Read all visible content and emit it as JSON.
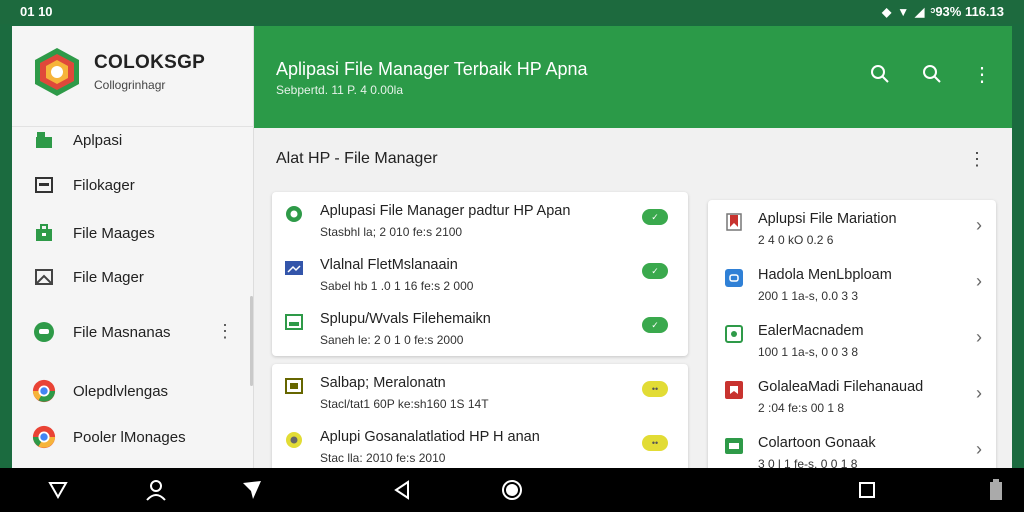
{
  "status_bar": {
    "time": "01 10",
    "battery_text": "ᵓ93% 116.13"
  },
  "drawer": {
    "brand_name": "COLOKSGP",
    "brand_sub": "Collogrinhagr",
    "items": [
      {
        "label": "Aplpasi",
        "icon": "app-icon",
        "color": "#2e9a48"
      },
      {
        "label": "Filokager",
        "icon": "folder-icon",
        "color": "#333333"
      },
      {
        "label": "File Maages",
        "icon": "briefcase-icon",
        "color": "#2e9a48"
      },
      {
        "label": "File Mager",
        "icon": "image-icon",
        "color": "#444444"
      },
      {
        "label": "File Masnanas",
        "icon": "chat-icon",
        "color": "#2e9a48"
      },
      {
        "label": "Olepdlvlengas",
        "icon": "chrome-icon",
        "color": "#e94335"
      },
      {
        "label": "Pooler lMonages",
        "icon": "chrome-icon",
        "color": "#e94335"
      }
    ]
  },
  "appbar": {
    "title": "Aplipasi File Manager Terbaik HP Apna",
    "subtitle": "Sebpertd. 11 P. 4 0.00la",
    "color": "#2b9a48"
  },
  "main": {
    "section_title": "Alat HP - File Manager",
    "left_card_top": [
      {
        "title": "Aplupasi File Manager padtur HP Apan",
        "sub": "Stasbhl la; 2 010 fe:s 2100",
        "icon": "gear-icon",
        "icon_color": "#2e9a48",
        "pill_color": "#3aa94d"
      },
      {
        "title": "Vlalnal FletMslanaain",
        "sub": "Sabel hb 1 .0 1 16 fe:s 2 000",
        "icon": "image-icon",
        "icon_color": "#3355aa",
        "pill_color": "#3aa94d"
      },
      {
        "title": "Splupu/Wvals Filehemaikn",
        "sub": "Saneh le: 2 0 1 0 fe:s 2000",
        "icon": "image-icon",
        "icon_color": "#2e9a48",
        "pill_color": "#3aa94d"
      }
    ],
    "left_card_bottom": [
      {
        "title": "Salbap; Meralonatn",
        "sub": "Stacl/tat1 60P ke:sh160 1S 14T",
        "icon": "image-icon",
        "icon_color": "#666600",
        "pill_color": "#e2dc35"
      },
      {
        "title": "Aplupi Gosanalatlatiod HP H anan",
        "sub": "Stac lla: 2010 fe:s 2010",
        "icon": "gear-icon",
        "icon_color": "#e2dc35",
        "pill_color": "#e2dc35"
      }
    ],
    "right_card": [
      {
        "title": "Aplupsi File Mariation",
        "sub": "2 4 0 kO 0.2 6",
        "icon": "bookmark-icon",
        "icon_color": "#c8332f"
      },
      {
        "title": "Hadola MenLbploam",
        "sub": "200 1 1a-s, 0.0 3 3",
        "icon": "chat-icon",
        "icon_color": "#2f80d6"
      },
      {
        "title": "EalerMacnadem",
        "sub": "100 1 1a-s, 0 0 3 8",
        "icon": "image-icon",
        "icon_color": "#2e9a48"
      },
      {
        "title": "GolaleaMadi Filehanauad",
        "sub": "2 :04 fe:s 00 1 8",
        "icon": "bookmark-icon",
        "icon_color": "#c8332f"
      },
      {
        "title": "Colartoon Gonaak",
        "sub": "3 0 l 1 fe-s, 0 0 1 8",
        "icon": "folder-icon",
        "icon_color": "#2e9a48"
      }
    ]
  }
}
